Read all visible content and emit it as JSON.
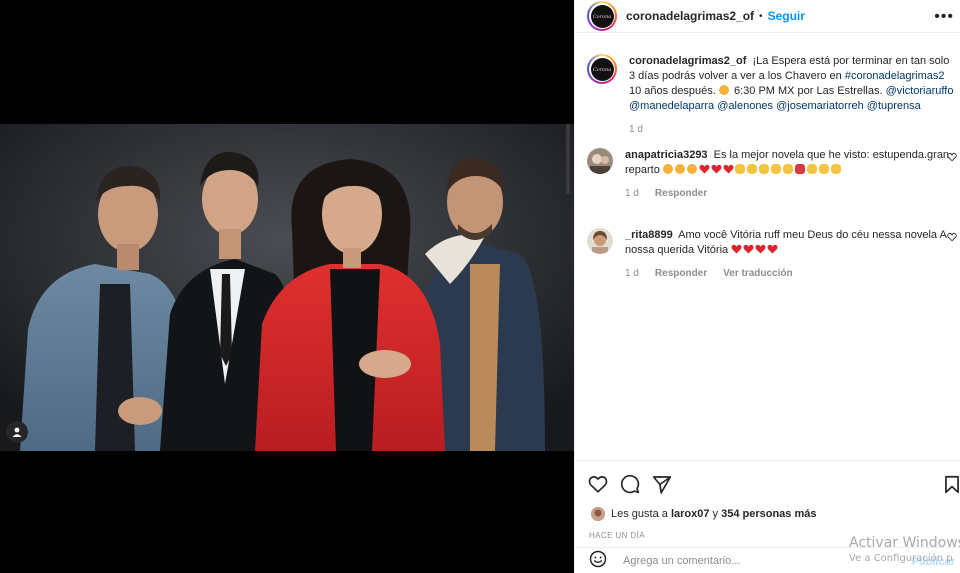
{
  "post": {
    "username": "coronadelagrimas2_of",
    "follow_label": "Seguir",
    "more_label": "•••",
    "logo_text": "Corona de Lágrimas",
    "caption": {
      "username": "coronadelagrimas2_of",
      "text_1": "¡La Espera está por terminar en tan solo 3 días podrás volver a ver a los Chavero en",
      "hashtag": "#coronadelagrimas2",
      "text_2": "10 años después.",
      "text_3": "6:30 PM MX por Las Estrellas.",
      "mentions": [
        "@victoriaruffo",
        "@manedelaparra",
        "@alenones",
        "@josemariatorreh",
        "@tuprensa"
      ],
      "time": "1 d"
    }
  },
  "comments": [
    {
      "username": "anapatricia3293",
      "text": "Es la mejor novela que he visto: estupenda.gran reparto",
      "time": "1 d",
      "reply_label": "Responder",
      "translate_label": ""
    },
    {
      "username": "_rita8899",
      "text": "Amo você Vitória ruff meu Deus do céu nessa novela A nossa querida Vitória",
      "time": "1 d",
      "reply_label": "Responder",
      "translate_label": "Ver traducción"
    }
  ],
  "likes": {
    "prefix": "Les gusta a",
    "user": "larox07",
    "connector": "y",
    "count_text": "354 personas más"
  },
  "time_ago": "HACE UN DÍA",
  "add_comment": {
    "placeholder": "Agrega un comentario...",
    "publish_label": "Publicar"
  },
  "windows_watermark": {
    "line1": "Activar Windows",
    "line2": "Ve a Configuración p"
  },
  "colors": {
    "accent": "#0095f6",
    "link": "#00376b",
    "muted": "#8e8e8e",
    "media_bg": "#000000",
    "jacket_red": "#d8262b"
  },
  "icons": [
    "heart-icon",
    "comment-icon",
    "share-icon",
    "bookmark-icon",
    "emoji-icon",
    "tag-user-icon",
    "more-icon"
  ]
}
